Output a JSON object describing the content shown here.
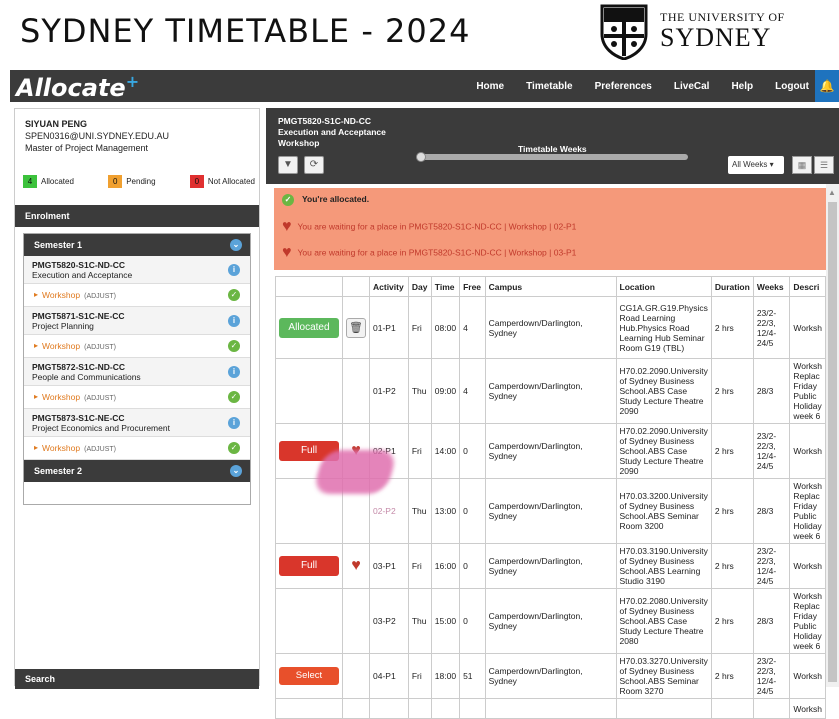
{
  "poster": {
    "title": "SYDNEY TIMETABLE - 2024",
    "uni_small": "THE UNIVERSITY OF",
    "uni_big": "SYDNEY"
  },
  "app": {
    "brand": "Allocate",
    "brand_sup": "+",
    "nav": [
      "Home",
      "Timetable",
      "Preferences",
      "LiveCal",
      "Help",
      "Logout"
    ]
  },
  "user": {
    "name": "SIYUAN PENG",
    "email": "SPEN0316@UNI.SYDNEY.EDU.AU",
    "degree": "Master of Project Management"
  },
  "legend": [
    {
      "count": "4",
      "label": "Allocated",
      "color": "#3cc23c"
    },
    {
      "count": "0",
      "label": "Pending",
      "color": "#f0a030"
    },
    {
      "count": "0",
      "label": "Not Allocated",
      "color": "#e03030"
    }
  ],
  "enrolment": {
    "title": "Enrolment",
    "semester1": "Semester 1",
    "semester2": "Semester 2",
    "courses": [
      {
        "code": "PMGT5820-S1C-ND-CC",
        "name": "Execution and Acceptance",
        "activity": "Workshop",
        "adjust": "(ADJUST)"
      },
      {
        "code": "PMGT5871-S1C-NE-CC",
        "name": "Project Planning",
        "activity": "Workshop",
        "adjust": "(ADJUST)"
      },
      {
        "code": "PMGT5872-S1C-ND-CC",
        "name": "People and Communications",
        "activity": "Workshop",
        "adjust": "(ADJUST)"
      },
      {
        "code": "PMGT5873-S1C-NE-CC",
        "name": "Project Economics and Procurement",
        "activity": "Workshop",
        "adjust": "(ADJUST)"
      }
    ],
    "search": "Search"
  },
  "detail": {
    "code": "PMGT5820-S1C-ND-CC",
    "name": "Execution and Acceptance",
    "activity": "Workshop",
    "weeks_label": "Timetable Weeks",
    "weeks_select": "All Weeks ▾"
  },
  "alerts": {
    "allocated": "You're allocated.",
    "wait1": "You are waiting for a place in PMGT5820-S1C-ND-CC | Workshop | 02-P1",
    "wait2": "You are waiting for a place in PMGT5820-S1C-ND-CC | Workshop | 03-P1"
  },
  "table": {
    "headers": [
      "Activity",
      "Day",
      "Time",
      "Free",
      "Campus",
      "Location",
      "Duration",
      "Weeks",
      "Descri"
    ],
    "rows": [
      {
        "btn": "Allocated",
        "btn_type": "alloc",
        "icon": "trash",
        "activity": "01-P1",
        "day": "Fri",
        "time": "08:00",
        "free": "4",
        "campus": "Camperdown/Darlington, Sydney",
        "location": "CG1A.GR.G19.Physics Road Learning Hub.Physics Road Learning Hub Seminar Room G19 (TBL)",
        "duration": "2 hrs",
        "weeks": "23/2-22/3, 12/4-24/5",
        "desc": "Worksh"
      },
      {
        "btn": "",
        "btn_type": "",
        "icon": "",
        "activity": "01-P2",
        "day": "Thu",
        "time": "09:00",
        "free": "4",
        "campus": "Camperdown/Darlington, Sydney",
        "location": "H70.02.2090.University of Sydney Business School.ABS Case Study Lecture Theatre 2090",
        "duration": "2 hrs",
        "weeks": "28/3",
        "desc": "Worksh Replac Friday Public Holiday week 6"
      },
      {
        "btn": "Full",
        "btn_type": "full",
        "icon": "heart",
        "activity": "02-P1",
        "day": "Fri",
        "time": "14:00",
        "free": "0",
        "campus": "Camperdown/Darlington, Sydney",
        "location": "H70.02.2090.University of Sydney Business School.ABS Case Study Lecture Theatre 2090",
        "duration": "2 hrs",
        "weeks": "23/2-22/3, 12/4-24/5",
        "desc": "Worksh"
      },
      {
        "btn": "",
        "btn_type": "",
        "icon": "",
        "activity": "02-P2",
        "day": "Thu",
        "time": "13:00",
        "free": "0",
        "campus": "Camperdown/Darlington, Sydney",
        "location": "H70.03.3200.University of Sydney Business School.ABS Seminar Room 3200",
        "duration": "2 hrs",
        "weeks": "28/3",
        "desc": "Worksh Replac Friday Public Holiday week 6"
      },
      {
        "btn": "Full",
        "btn_type": "full",
        "icon": "heart",
        "activity": "03-P1",
        "day": "Fri",
        "time": "16:00",
        "free": "0",
        "campus": "Camperdown/Darlington, Sydney",
        "location": "H70.03.3190.University of Sydney Business School.ABS Learning Studio 3190",
        "duration": "2 hrs",
        "weeks": "23/2-22/3, 12/4-24/5",
        "desc": "Worksh"
      },
      {
        "btn": "",
        "btn_type": "",
        "icon": "",
        "activity": "03-P2",
        "day": "Thu",
        "time": "15:00",
        "free": "0",
        "campus": "Camperdown/Darlington, Sydney",
        "location": "H70.02.2080.University of Sydney Business School.ABS Case Study Lecture Theatre 2080",
        "duration": "2 hrs",
        "weeks": "28/3",
        "desc": "Worksh Replac Friday Public Holiday week 6"
      },
      {
        "btn": "Select",
        "btn_type": "select",
        "icon": "",
        "activity": "04-P1",
        "day": "Fri",
        "time": "18:00",
        "free": "51",
        "campus": "Camperdown/Darlington, Sydney",
        "location": "H70.03.3270.University of Sydney Business School.ABS Seminar Room 3270",
        "duration": "2 hrs",
        "weeks": "23/2-22/3, 12/4-24/5",
        "desc": "Worksh"
      },
      {
        "btn": "",
        "btn_type": "",
        "icon": "",
        "activity": "",
        "day": "",
        "time": "",
        "free": "",
        "campus": "",
        "location": "",
        "duration": "",
        "weeks": "",
        "desc": "Worksh"
      }
    ]
  }
}
